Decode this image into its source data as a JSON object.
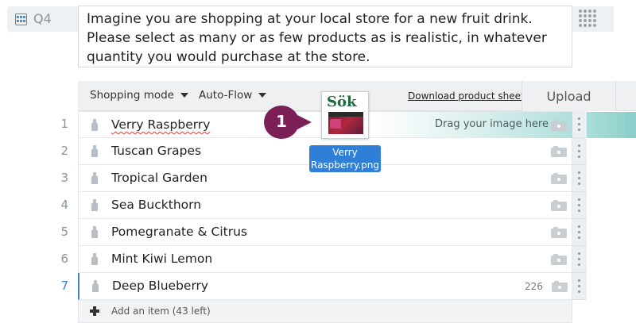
{
  "question": {
    "id": "Q4",
    "text": "Imagine you are shopping at your local store for a new fruit drink. Please select as many or as few products as is realistic, in whatever quantity you would purchase at the store."
  },
  "toolbar": {
    "shopping_mode": "Shopping mode",
    "auto_flow": "Auto-Flow",
    "download": "Download product sheet",
    "upload": "Upload"
  },
  "items": [
    {
      "num": "1",
      "label": "Verry Raspberry",
      "count": ""
    },
    {
      "num": "2",
      "label": "Tuscan Grapes",
      "count": ""
    },
    {
      "num": "3",
      "label": "Tropical Garden",
      "count": ""
    },
    {
      "num": "4",
      "label": "Sea Buckthorn",
      "count": ""
    },
    {
      "num": "5",
      "label": "Pomegranate & Citrus",
      "count": ""
    },
    {
      "num": "6",
      "label": "Mint Kiwi Lemon",
      "count": ""
    },
    {
      "num": "7",
      "label": "Deep Blueberry",
      "count": "226"
    }
  ],
  "drop_hint": "Drag your image here",
  "add_item": "Add an item (43 left)",
  "dragged_file": {
    "brand": "Sök",
    "caption": "Verry Raspberry.png"
  },
  "step_marker": "1",
  "colors": {
    "accent_blue": "#3a86c8",
    "step_purple": "#7b1f56",
    "drop_teal": "#92d1cd",
    "caption_blue": "#2f7fd8"
  },
  "icons": {
    "question_type": "grid-icon",
    "item": "bottle-icon",
    "image": "camera-icon",
    "reorder": "drag-handle-icon",
    "add": "plus-icon"
  }
}
